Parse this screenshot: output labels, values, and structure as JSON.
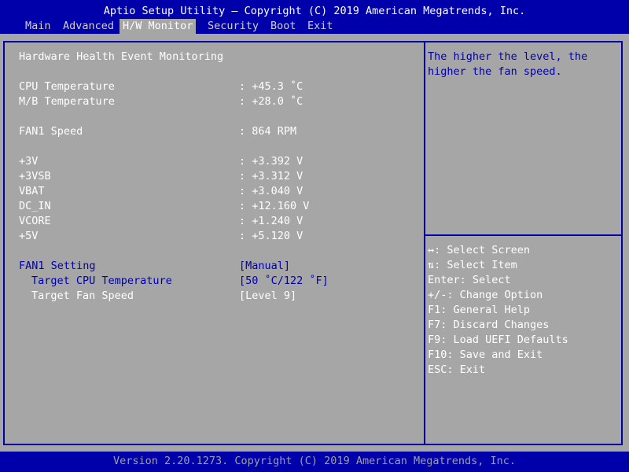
{
  "header": {
    "title": "Aptio Setup Utility – Copyright (C) 2019 American Megatrends, Inc.",
    "tabs": [
      {
        "label": "Main"
      },
      {
        "label": "Advanced"
      },
      {
        "label": "H/W Monitor"
      },
      {
        "label": "Security"
      },
      {
        "label": "Boot"
      },
      {
        "label": "Exit"
      }
    ],
    "active_tab": "H/W Monitor"
  },
  "main": {
    "section_title": "Hardware Health Event Monitoring",
    "readings": [
      {
        "label": "CPU Temperature",
        "value": ": +45.3 ˚C"
      },
      {
        "label": "M/B Temperature",
        "value": ": +28.0 ˚C"
      },
      {
        "label": "FAN1 Speed",
        "value": ": 864 RPM"
      },
      {
        "label": "+3V",
        "value": ": +3.392 V"
      },
      {
        "label": "+3VSB",
        "value": ": +3.312 V"
      },
      {
        "label": "VBAT",
        "value": ": +3.040 V"
      },
      {
        "label": "DC_IN",
        "value": ": +12.160 V"
      },
      {
        "label": "VCORE",
        "value": ": +1.240 V"
      },
      {
        "label": "+5V",
        "value": ": +5.120 V"
      }
    ],
    "settings": [
      {
        "label": "FAN1 Setting",
        "value": "[Manual]"
      },
      {
        "label": "Target CPU Temperature",
        "value": "[50 ˚C/122 ˚F]"
      },
      {
        "label": "Target Fan Speed",
        "value": "[Level 9]"
      }
    ]
  },
  "help": {
    "text": "The higher the level, the higher the fan speed."
  },
  "keys": [
    "↔: Select Screen",
    "⇅: Select Item",
    "Enter: Select",
    "+/-: Change Option",
    "F1: General Help",
    "F7: Discard Changes",
    "F9: Load UEFI Defaults",
    "F10: Save and Exit",
    "ESC: Exit"
  ],
  "footer": {
    "text": "Version 2.20.1273. Copyright (C) 2019 American Megatrends, Inc."
  },
  "colors": {
    "bios_blue": "#0000aa",
    "panel_gray": "#a6a6a6",
    "text_white": "#ffffff"
  }
}
